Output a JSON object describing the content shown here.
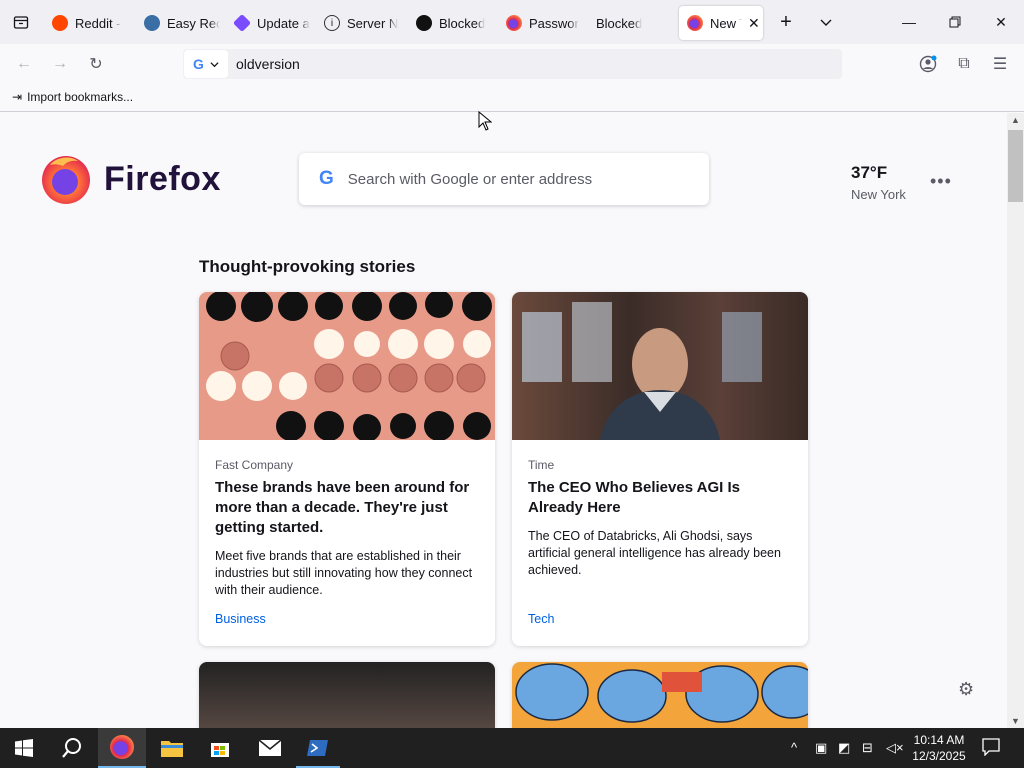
{
  "tabs": [
    {
      "label": "Reddit -",
      "color": "#ff4500"
    },
    {
      "label": "Easy Rec",
      "color": "#3a6ea5"
    },
    {
      "label": "Update a",
      "color": "#7b4cff"
    },
    {
      "label": "Server N",
      "color": "#333333"
    },
    {
      "label": "Blocked",
      "color": "#111111"
    },
    {
      "label": "Passwor",
      "color": "#e22850"
    },
    {
      "label": "Blocked",
      "color": ""
    },
    {
      "label": "New T",
      "color": "#ff7139"
    }
  ],
  "urlbar": {
    "value": "oldversion"
  },
  "bookmarks": {
    "import_label": "Import bookmarks..."
  },
  "newtab": {
    "brand": "Firefox",
    "search_placeholder": "Search with Google or enter address",
    "weather": {
      "temp": "37°F",
      "city": "New York"
    },
    "section_title": "Thought-provoking stories",
    "cards": [
      {
        "source": "Fast Company",
        "title": "These brands have been around for more than a decade. They're just getting started.",
        "description": "Meet five brands that are established in their industries but still innovating how they connect with their audience.",
        "category": "Business"
      },
      {
        "source": "Time",
        "title": "The CEO Who Believes AGI Is Already Here",
        "description": "The CEO of Databricks, Ali Ghodsi, says artificial general intelligence has already been achieved.",
        "category": "Tech"
      }
    ]
  },
  "taskbar": {
    "time": "10:14 AM",
    "date": "12/3/2025"
  },
  "colors": {
    "accent": "#0061e0",
    "taskbar": "#202020",
    "tab_strip": "#f0f0f4"
  }
}
